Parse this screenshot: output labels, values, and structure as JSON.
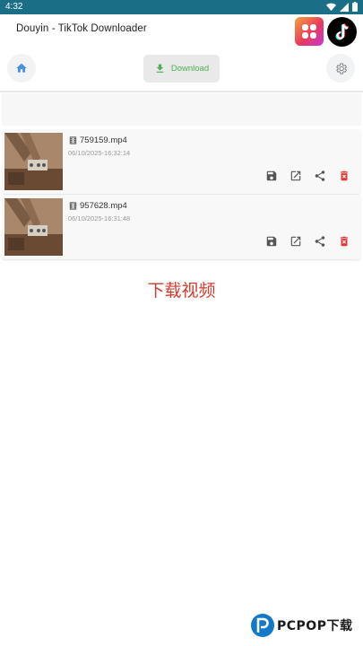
{
  "status_bar": {
    "time": "4:32"
  },
  "header": {
    "title": "Douyin - TikTok Downloader"
  },
  "toolbar": {
    "download_label": "Download"
  },
  "videos": [
    {
      "name": "759159.mp4",
      "date": "06/10/2025-16:32:14"
    },
    {
      "name": "957628.mp4",
      "date": "06/10/2025-16:31:48"
    }
  ],
  "promo_caption": "下载视频",
  "watermark": {
    "text": "PCPOP下载"
  },
  "colors": {
    "status_bar": "#1a6e86",
    "accent_green": "#4caf50",
    "delete_red": "#e53935",
    "caption_red": "#d23b2c",
    "home_blue": "#4a8fd8"
  }
}
